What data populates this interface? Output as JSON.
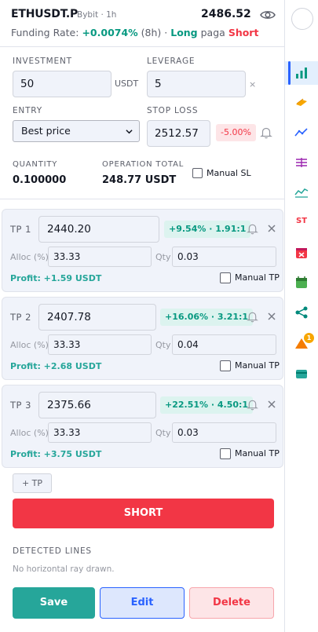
{
  "header": {
    "symbol": "ETHUSDT.P",
    "exchange": "Bybit · 1h",
    "price": "2486.52",
    "funding_label": "Funding Rate:",
    "funding_rate": "+0.0074%",
    "funding_period": "(8h) ·",
    "long_text": "Long",
    "paga_text": "paga",
    "short_text": "Short"
  },
  "form": {
    "investment_label": "INVESTMENT",
    "investment_value": "50",
    "investment_unit": "USDT",
    "leverage_label": "LEVERAGE",
    "leverage_value": "5",
    "leverage_unit": "×",
    "entry_label": "ENTRY",
    "entry_value": "Best price",
    "stop_loss_label": "STOP LOSS",
    "stop_loss_value": "2512.57",
    "stop_loss_pct": "-5.00%",
    "quantity_label": "QUANTITY",
    "quantity_value": "0.100000",
    "op_total_label": "OPERATION TOTAL",
    "op_total_value": "248.77 USDT",
    "manual_sl_label": "Manual SL"
  },
  "take_profits": [
    {
      "label": "TP 1",
      "price": "2440.20",
      "badge": "+9.54% · 1.91:1",
      "alloc_label": "Alloc (%)",
      "alloc": "33.33",
      "qty_label": "Qty",
      "qty": "0.03",
      "profit": "Profit: +1.59 USDT",
      "manual_label": "Manual TP"
    },
    {
      "label": "TP 2",
      "price": "2407.78",
      "badge": "+16.06% · 3.21:1",
      "alloc_label": "Alloc (%)",
      "alloc": "33.33",
      "qty_label": "Qty",
      "qty": "0.04",
      "profit": "Profit: +2.68 USDT",
      "manual_label": "Manual TP"
    },
    {
      "label": "TP 3",
      "price": "2375.66",
      "badge": "+22.51% · 4.50:1",
      "alloc_label": "Alloc (%)",
      "alloc": "33.33",
      "qty_label": "Qty",
      "qty": "0.03",
      "profit": "Profit: +3.75 USDT",
      "manual_label": "Manual TP"
    }
  ],
  "actions": {
    "add_tp": "+ TP",
    "short": "SHORT",
    "detected_label": "DETECTED LINES",
    "detected_empty": "No horizontal ray drawn.",
    "save": "Save",
    "edit": "Edit",
    "delete": "Delete"
  },
  "sidebar": {
    "st_label": "ST",
    "alert_count": "1",
    "icons": [
      "bar-chart-icon",
      "ruler-icon",
      "trend-icon",
      "levels-icon",
      "wave-icon",
      "st-icon",
      "calendar-x-icon",
      "calendar-icon",
      "share-icon",
      "alert-icon",
      "card-icon"
    ]
  },
  "colors": {
    "green": "#089981",
    "red": "#f23645",
    "blue": "#2962ff",
    "teal": "#26a69a"
  }
}
